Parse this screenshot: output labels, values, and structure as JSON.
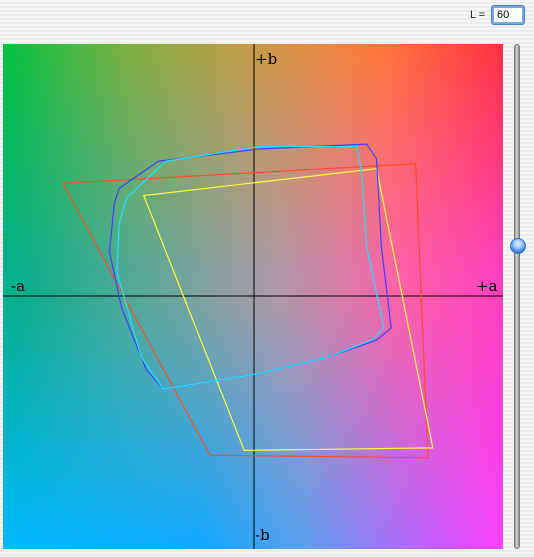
{
  "lightness": {
    "label": "L =",
    "value": "60",
    "slider_fraction_from_top": 0.4
  },
  "axes": {
    "plus_b": "+b",
    "minus_b": "-b",
    "minus_a": "-a",
    "plus_a": "+a"
  },
  "gamuts": [
    {
      "color": "#ff4a2a",
      "points": [
        [
          -78,
          46
        ],
        [
          66,
          54
        ],
        [
          71,
          -66
        ],
        [
          -18,
          -65
        ]
      ]
    },
    {
      "color": "#ffff40",
      "points": [
        [
          -45,
          41
        ],
        [
          50,
          52
        ],
        [
          73,
          -62
        ],
        [
          -4,
          -63
        ]
      ]
    },
    {
      "color": "#4040ff",
      "points": [
        [
          -55,
          44
        ],
        [
          -39,
          55
        ],
        [
          2,
          60
        ],
        [
          46,
          62
        ],
        [
          50,
          56
        ],
        [
          52,
          20
        ],
        [
          56,
          -13
        ],
        [
          50,
          -18
        ],
        [
          30,
          -25
        ],
        [
          0,
          -32
        ],
        [
          -37,
          -38
        ],
        [
          -44,
          -30
        ],
        [
          -54,
          -5
        ],
        [
          -59,
          18
        ],
        [
          -57,
          38
        ]
      ]
    },
    {
      "color": "#20e0ff",
      "points": [
        [
          -52,
          40
        ],
        [
          -36,
          55
        ],
        [
          2,
          61
        ],
        [
          42,
          61
        ],
        [
          44,
          50
        ],
        [
          46,
          20
        ],
        [
          53,
          -13
        ],
        [
          48,
          -18
        ],
        [
          30,
          -25
        ],
        [
          0,
          -32
        ],
        [
          -37,
          -38
        ],
        [
          -46,
          -25
        ],
        [
          -56,
          10
        ],
        [
          -55,
          30
        ]
      ]
    }
  ],
  "colors": {
    "axis": "#000000",
    "slider_accent": "#3d7fdc"
  }
}
